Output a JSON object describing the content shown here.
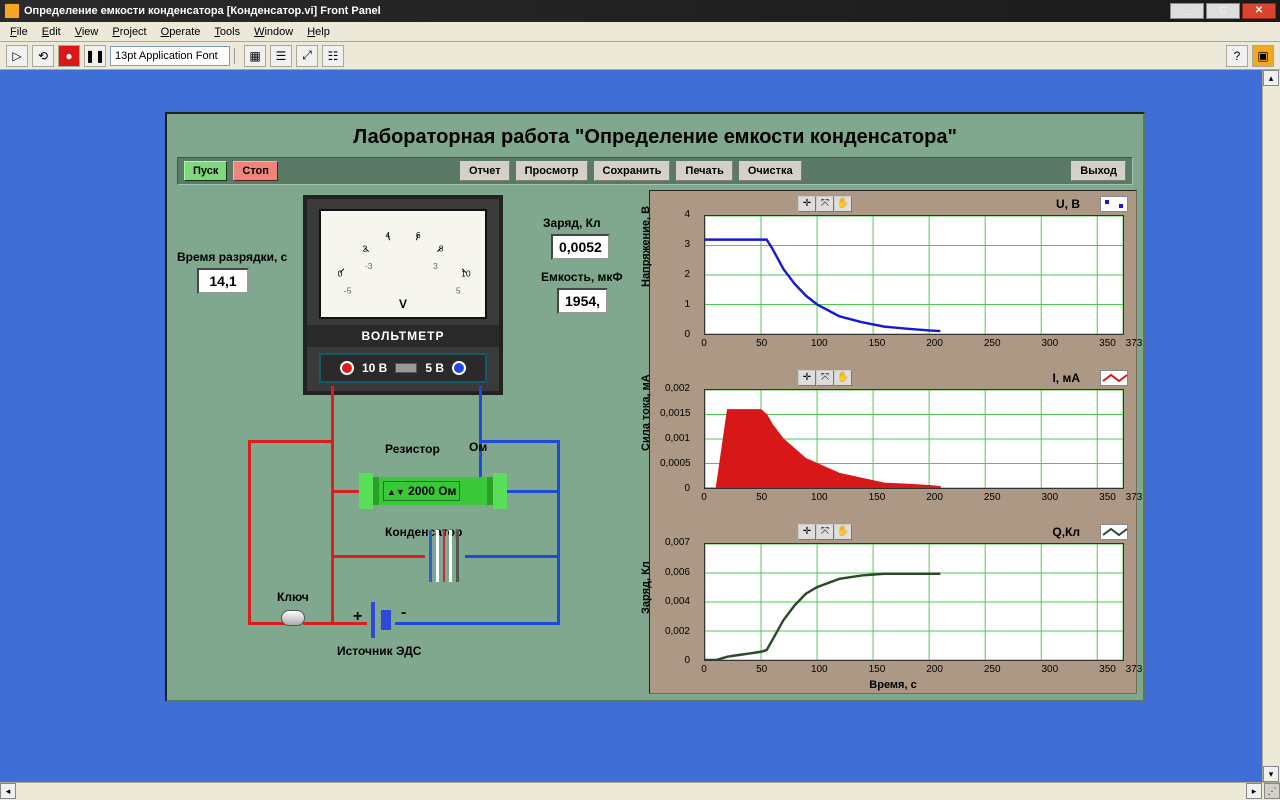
{
  "window": {
    "title": "Определение емкости конденсатора [Конденсатор.vi] Front Panel"
  },
  "menu": [
    "File",
    "Edit",
    "View",
    "Project",
    "Operate",
    "Tools",
    "Window",
    "Help"
  ],
  "toolbar": {
    "font": "13pt Application Font"
  },
  "panel": {
    "title": "Лабораторная работа \"Определение емкости конденсатора\"",
    "buttons": {
      "start": "Пуск",
      "stop": "Стоп",
      "report": "Отчет",
      "preview": "Просмотр",
      "save": "Сохранить",
      "print": "Печать",
      "clear": "Очистка",
      "exit": "Выход"
    }
  },
  "readouts": {
    "time_label": "Время разрядки, с",
    "time_val": "14,1",
    "charge_label": "Заряд, Кл",
    "charge_val": "0,0052",
    "cap_label": "Емкость, мкФ",
    "cap_val": "1954,"
  },
  "voltmeter": {
    "name": "ВОЛЬТМЕТР",
    "unit": "V",
    "range10": "10 В",
    "range5": "5 В",
    "ticks": [
      0,
      2,
      4,
      6,
      8,
      10
    ],
    "ticks2": [
      -5,
      -3,
      3,
      5
    ]
  },
  "circuit": {
    "resistor_label": "Резистор",
    "resistor_unit": "Ом",
    "resistor_val": "2000 Ом",
    "cap_label": "Конденсатор",
    "switch_label": "Ключ",
    "source_label": "Источник ЭДС",
    "plus": "+",
    "minus": "-"
  },
  "charts": {
    "xlabel": "Время, с",
    "xlim": [
      0,
      373
    ],
    "xticks": [
      0,
      50,
      100,
      150,
      200,
      250,
      300,
      350,
      373
    ],
    "chart1": {
      "series": "U, В",
      "ylabel": "Напряжение, В",
      "yticks": [
        "0",
        "1",
        "2",
        "3",
        "4"
      ],
      "color": "#1818d0"
    },
    "chart2": {
      "series": "I, мА",
      "ylabel": "Сила тока, мА",
      "yticks": [
        "0",
        "0,0005",
        "0,001",
        "0,0015",
        "0,002"
      ],
      "color": "#d81818"
    },
    "chart3": {
      "series": "Q,Кл",
      "ylabel": "Заряд, Кл",
      "yticks": [
        "0",
        "0,002",
        "0,004",
        "0,006",
        "0,007"
      ],
      "color": "#2a4a2a"
    }
  },
  "chart_data": [
    {
      "type": "line",
      "title": "U, В",
      "xlabel": "Время, с",
      "ylabel": "Напряжение, В",
      "xlim": [
        0,
        373
      ],
      "ylim": [
        0,
        4
      ],
      "x": [
        0,
        10,
        20,
        30,
        40,
        50,
        55,
        60,
        70,
        80,
        90,
        100,
        120,
        140,
        160,
        180,
        200,
        210
      ],
      "y": [
        3.2,
        3.2,
        3.2,
        3.2,
        3.2,
        3.2,
        3.2,
        2.9,
        2.2,
        1.7,
        1.3,
        1.0,
        0.6,
        0.4,
        0.25,
        0.18,
        0.12,
        0.1
      ]
    },
    {
      "type": "area",
      "title": "I, мА",
      "xlabel": "Время, с",
      "ylabel": "Сила тока, мА",
      "xlim": [
        0,
        373
      ],
      "ylim": [
        0,
        0.002
      ],
      "x": [
        0,
        10,
        20,
        30,
        40,
        50,
        55,
        60,
        70,
        80,
        90,
        100,
        120,
        140,
        160,
        180,
        200,
        210
      ],
      "y": [
        0,
        0,
        0.0016,
        0.0016,
        0.0016,
        0.0016,
        0.0015,
        0.0013,
        0.001,
        0.0008,
        0.0006,
        0.0005,
        0.0003,
        0.0002,
        0.0001,
        8e-05,
        5e-05,
        3e-05
      ]
    },
    {
      "type": "line",
      "title": "Q,Кл",
      "xlabel": "Время, с",
      "ylabel": "Заряд, Кл",
      "xlim": [
        0,
        373
      ],
      "ylim": [
        0,
        0.007
      ],
      "x": [
        0,
        10,
        20,
        30,
        40,
        50,
        55,
        60,
        70,
        80,
        90,
        100,
        120,
        140,
        160,
        180,
        200,
        210
      ],
      "y": [
        0,
        0,
        0.0002,
        0.0003,
        0.0004,
        0.0005,
        0.0006,
        0.0012,
        0.0024,
        0.0033,
        0.004,
        0.0044,
        0.0049,
        0.0051,
        0.0052,
        0.0052,
        0.0052,
        0.0052
      ]
    }
  ]
}
